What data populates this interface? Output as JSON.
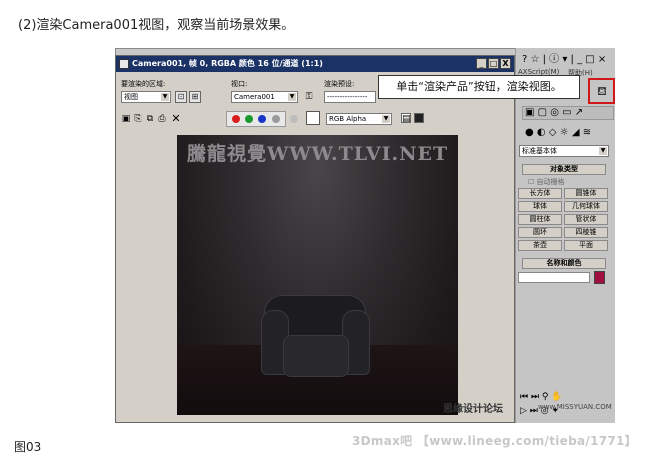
{
  "step_caption": "(2)渲染Camera001视图，观察当前场景效果。",
  "figure_caption": "图03",
  "footer_watermark": "3Dmax吧 【www.lineeg.com/tieba/1771】",
  "callout": "单击“渲染产品”按钮，渲染视图。",
  "render_window": {
    "title": "Camera001, 帧 0, RGBA 颜色 16 位/通道 (1:1)",
    "area_label": "要渲染的区域:",
    "area_value": "视图",
    "viewport_label": "视口:",
    "viewport_value": "Camera001",
    "preset_label": "渲染预设:",
    "preset_value": "----------------",
    "channel_value": "RGB Alpha",
    "min_label": "_",
    "max_label": "□",
    "close_label": "X"
  },
  "view_watermark": "騰龍視覺WWW.TLVI.NET",
  "forum_watermark": "思缘设计论坛",
  "missyuan": "www.MISSYUAN.COM",
  "max_panel": {
    "help_menu": "帮助(H)",
    "script_menu": "AXScript(M)",
    "category": "标准基本体",
    "rollout_object_type": "对象类型",
    "autogrid": "自动栅格",
    "buttons": [
      "长方体",
      "圆锥体",
      "球体",
      "几何球体",
      "圆柱体",
      "管状体",
      "圆环",
      "四棱锥",
      "茶壶",
      "平面"
    ],
    "rollout_name_color": "名称和颜色",
    "color_swatch": "#a01040"
  },
  "colors": {
    "title_bar": "#1a3266",
    "callout_border": "#d01818"
  }
}
